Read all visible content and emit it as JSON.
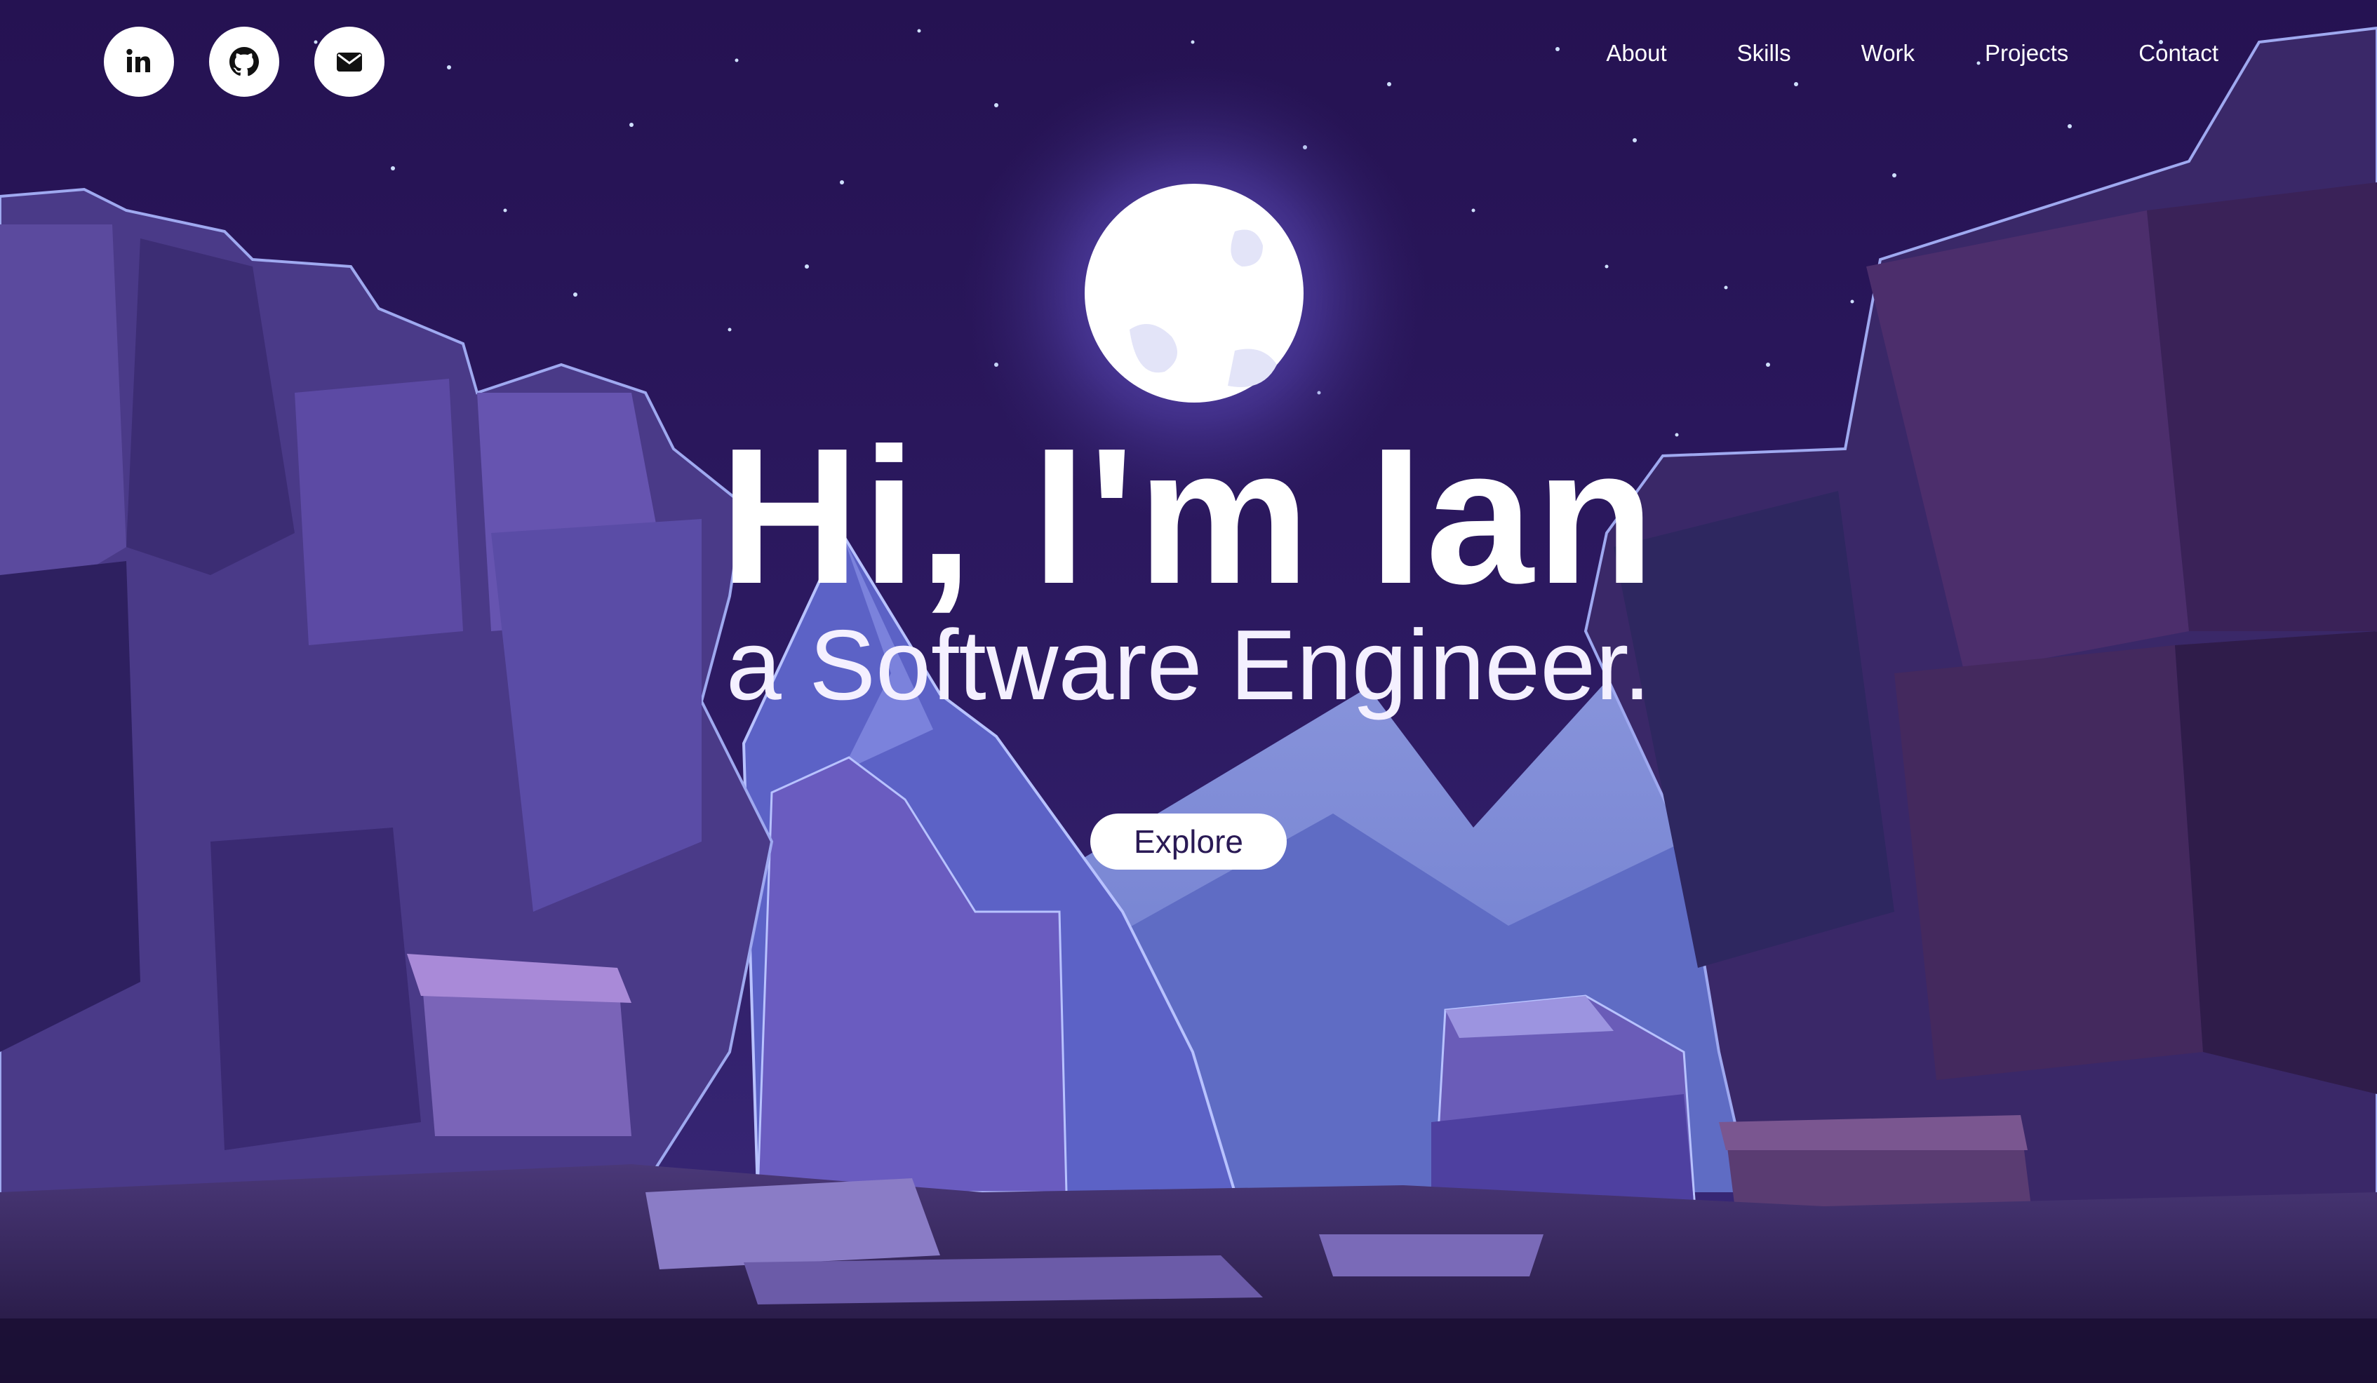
{
  "social": [
    {
      "icon": "linkedin-icon",
      "glyph": "in"
    },
    {
      "icon": "github-icon"
    },
    {
      "icon": "mail-icon"
    }
  ],
  "nav": {
    "about": "About",
    "skills": "Skills",
    "work": "Work",
    "projects": "Projects",
    "contact": "Contact"
  },
  "hero": {
    "title": "Hi, I'm Ian",
    "subtitle": "a Software Engineer.",
    "cta": "Explore"
  },
  "colors": {
    "sky": "#2a1656",
    "moon": "#ffffff",
    "rock": "#5b4a9e",
    "button_text": "#2a1a55"
  }
}
